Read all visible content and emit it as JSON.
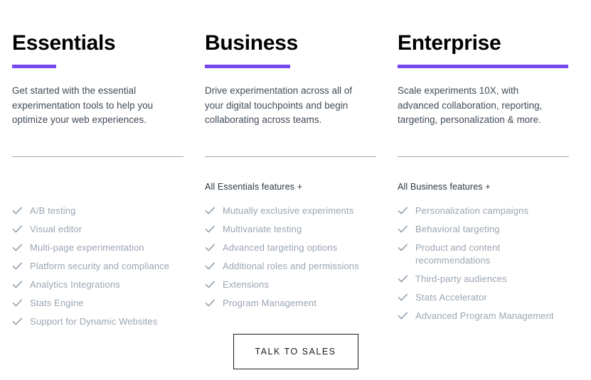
{
  "accent_color": "#7547ec",
  "divider_color": "#9aa7b2",
  "feature_text_color": "#9aa5b1",
  "plans": [
    {
      "name": "Essentials",
      "description": "Get started with the essential experimentation tools to help you optimize your web experiences.",
      "features_heading": "",
      "features": [
        "A/B testing",
        "Visual editor",
        "Multi-page experimentation",
        "Platform security and compliance",
        "Analytics Integrations",
        "Stats Engine",
        "Support for Dynamic Websites"
      ]
    },
    {
      "name": "Business",
      "description": "Drive experimentation across all of your digital touchpoints and begin collaborating across teams.",
      "features_heading": "All Essentials features +",
      "features": [
        "Mutually exclusive experiments",
        "Multivariate testing",
        "Advanced targeting options",
        "Additional roles and permissions",
        "Extensions",
        "Program Management"
      ]
    },
    {
      "name": "Enterprise",
      "description": "Scale experiments 10X, with advanced collaboration, reporting, targeting, personalization & more.",
      "features_heading": "All Business features +",
      "features": [
        "Personalization campaigns",
        "Behavioral targeting",
        "Product and content recommendations",
        "Third-party audiences",
        "Stats Accelerator",
        "Advanced Program Management"
      ]
    }
  ],
  "cta": {
    "label": "TALK TO SALES",
    "icon": "none"
  }
}
